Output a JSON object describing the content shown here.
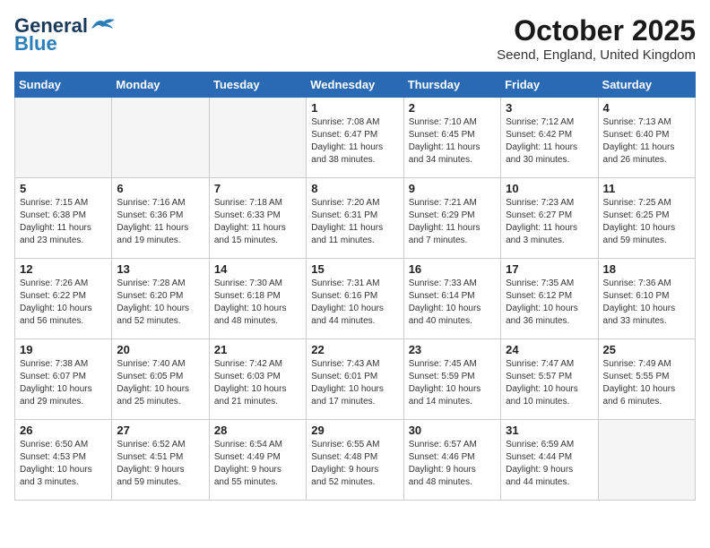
{
  "header": {
    "logo_line1": "General",
    "logo_line2": "Blue",
    "month": "October 2025",
    "location": "Seend, England, United Kingdom"
  },
  "days_of_week": [
    "Sunday",
    "Monday",
    "Tuesday",
    "Wednesday",
    "Thursday",
    "Friday",
    "Saturday"
  ],
  "weeks": [
    [
      {
        "day": "",
        "content": ""
      },
      {
        "day": "",
        "content": ""
      },
      {
        "day": "",
        "content": ""
      },
      {
        "day": "1",
        "content": "Sunrise: 7:08 AM\nSunset: 6:47 PM\nDaylight: 11 hours\nand 38 minutes."
      },
      {
        "day": "2",
        "content": "Sunrise: 7:10 AM\nSunset: 6:45 PM\nDaylight: 11 hours\nand 34 minutes."
      },
      {
        "day": "3",
        "content": "Sunrise: 7:12 AM\nSunset: 6:42 PM\nDaylight: 11 hours\nand 30 minutes."
      },
      {
        "day": "4",
        "content": "Sunrise: 7:13 AM\nSunset: 6:40 PM\nDaylight: 11 hours\nand 26 minutes."
      }
    ],
    [
      {
        "day": "5",
        "content": "Sunrise: 7:15 AM\nSunset: 6:38 PM\nDaylight: 11 hours\nand 23 minutes."
      },
      {
        "day": "6",
        "content": "Sunrise: 7:16 AM\nSunset: 6:36 PM\nDaylight: 11 hours\nand 19 minutes."
      },
      {
        "day": "7",
        "content": "Sunrise: 7:18 AM\nSunset: 6:33 PM\nDaylight: 11 hours\nand 15 minutes."
      },
      {
        "day": "8",
        "content": "Sunrise: 7:20 AM\nSunset: 6:31 PM\nDaylight: 11 hours\nand 11 minutes."
      },
      {
        "day": "9",
        "content": "Sunrise: 7:21 AM\nSunset: 6:29 PM\nDaylight: 11 hours\nand 7 minutes."
      },
      {
        "day": "10",
        "content": "Sunrise: 7:23 AM\nSunset: 6:27 PM\nDaylight: 11 hours\nand 3 minutes."
      },
      {
        "day": "11",
        "content": "Sunrise: 7:25 AM\nSunset: 6:25 PM\nDaylight: 10 hours\nand 59 minutes."
      }
    ],
    [
      {
        "day": "12",
        "content": "Sunrise: 7:26 AM\nSunset: 6:22 PM\nDaylight: 10 hours\nand 56 minutes."
      },
      {
        "day": "13",
        "content": "Sunrise: 7:28 AM\nSunset: 6:20 PM\nDaylight: 10 hours\nand 52 minutes."
      },
      {
        "day": "14",
        "content": "Sunrise: 7:30 AM\nSunset: 6:18 PM\nDaylight: 10 hours\nand 48 minutes."
      },
      {
        "day": "15",
        "content": "Sunrise: 7:31 AM\nSunset: 6:16 PM\nDaylight: 10 hours\nand 44 minutes."
      },
      {
        "day": "16",
        "content": "Sunrise: 7:33 AM\nSunset: 6:14 PM\nDaylight: 10 hours\nand 40 minutes."
      },
      {
        "day": "17",
        "content": "Sunrise: 7:35 AM\nSunset: 6:12 PM\nDaylight: 10 hours\nand 36 minutes."
      },
      {
        "day": "18",
        "content": "Sunrise: 7:36 AM\nSunset: 6:10 PM\nDaylight: 10 hours\nand 33 minutes."
      }
    ],
    [
      {
        "day": "19",
        "content": "Sunrise: 7:38 AM\nSunset: 6:07 PM\nDaylight: 10 hours\nand 29 minutes."
      },
      {
        "day": "20",
        "content": "Sunrise: 7:40 AM\nSunset: 6:05 PM\nDaylight: 10 hours\nand 25 minutes."
      },
      {
        "day": "21",
        "content": "Sunrise: 7:42 AM\nSunset: 6:03 PM\nDaylight: 10 hours\nand 21 minutes."
      },
      {
        "day": "22",
        "content": "Sunrise: 7:43 AM\nSunset: 6:01 PM\nDaylight: 10 hours\nand 17 minutes."
      },
      {
        "day": "23",
        "content": "Sunrise: 7:45 AM\nSunset: 5:59 PM\nDaylight: 10 hours\nand 14 minutes."
      },
      {
        "day": "24",
        "content": "Sunrise: 7:47 AM\nSunset: 5:57 PM\nDaylight: 10 hours\nand 10 minutes."
      },
      {
        "day": "25",
        "content": "Sunrise: 7:49 AM\nSunset: 5:55 PM\nDaylight: 10 hours\nand 6 minutes."
      }
    ],
    [
      {
        "day": "26",
        "content": "Sunrise: 6:50 AM\nSunset: 4:53 PM\nDaylight: 10 hours\nand 3 minutes."
      },
      {
        "day": "27",
        "content": "Sunrise: 6:52 AM\nSunset: 4:51 PM\nDaylight: 9 hours\nand 59 minutes."
      },
      {
        "day": "28",
        "content": "Sunrise: 6:54 AM\nSunset: 4:49 PM\nDaylight: 9 hours\nand 55 minutes."
      },
      {
        "day": "29",
        "content": "Sunrise: 6:55 AM\nSunset: 4:48 PM\nDaylight: 9 hours\nand 52 minutes."
      },
      {
        "day": "30",
        "content": "Sunrise: 6:57 AM\nSunset: 4:46 PM\nDaylight: 9 hours\nand 48 minutes."
      },
      {
        "day": "31",
        "content": "Sunrise: 6:59 AM\nSunset: 4:44 PM\nDaylight: 9 hours\nand 44 minutes."
      },
      {
        "day": "",
        "content": ""
      }
    ]
  ]
}
